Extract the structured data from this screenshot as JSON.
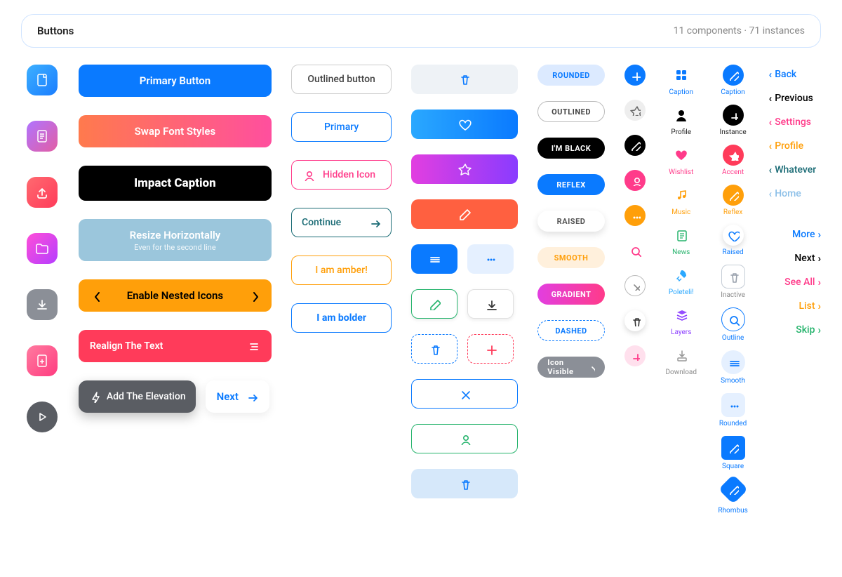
{
  "header": {
    "title": "Buttons",
    "meta": "11 components · 71 instances"
  },
  "col2": {
    "primary": "Primary Button",
    "swap": "Swap Font Styles",
    "impact": "Impact Caption",
    "resize": "Resize Horizontally",
    "resize_sub": "Even for the second line",
    "nested": "Enable Nested Icons",
    "realign": "Realign The Text",
    "elev": "Add The Elevation",
    "next": "Next"
  },
  "col3": {
    "outlined": "Outlined button",
    "primary": "Primary",
    "hidden": "Hidden Icon",
    "continue": "Continue",
    "amber": "I am amber!",
    "bolder": "I am bolder"
  },
  "pills": {
    "rounded": "ROUNDED",
    "outlined": "OUTLINED",
    "black": "I'M BLACK",
    "reflex": "REFLEX",
    "raised": "RAISED",
    "smooth": "SMOOTH",
    "gradient": "GRADIENT",
    "dashed": "DASHED",
    "iconvis": "Icon Visible"
  },
  "caps": {
    "caption": "Caption",
    "profile": "Profile",
    "wishlist": "Wishlist",
    "music": "Music",
    "news": "News",
    "poleteli": "Poleteli!",
    "layers": "Layers",
    "download": "Download",
    "instance": "Instance",
    "accent": "Accent",
    "reflex": "Reflex",
    "raised": "Raised",
    "inactive": "Inactive",
    "outline": "Outline",
    "smooth": "Smooth",
    "rounded": "Rounded",
    "square": "Square",
    "rhombus": "Rhombus"
  },
  "links": {
    "back": "Back",
    "previous": "Previous",
    "settings": "Settings",
    "profile": "Profile",
    "whatever": "Whatever",
    "home": "Home",
    "more": "More",
    "next": "Next",
    "seeall": "See All",
    "list": "List",
    "skip": "Skip"
  }
}
